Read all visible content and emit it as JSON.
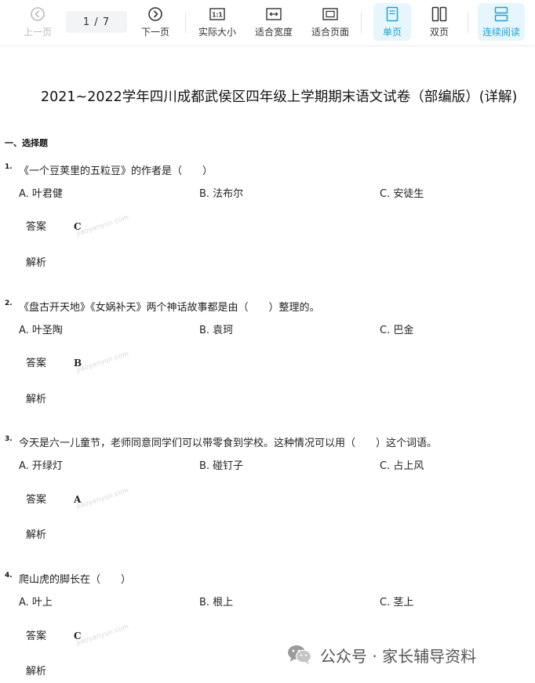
{
  "toolbar": {
    "prev_label": "上一页",
    "page_indicator": "1 / 7",
    "next_label": "下一页",
    "actual_size_label": "实际大小",
    "fit_width_label": "适合宽度",
    "fit_page_label": "适合页面",
    "single_page_label": "单页",
    "double_page_label": "双页",
    "continuous_label": "连续阅读",
    "actual_size_icon_text": "1:1",
    "accent_color": "#1aa3d6"
  },
  "document": {
    "title": "2021~2022学年四川成都武侯区四年级上学期期末语文试卷（部编版）(详解)",
    "section_heading": "一、选择题",
    "answer_label": "答案",
    "analysis_label": "解析",
    "watermark": "jiaoyanyun.com",
    "questions": [
      {
        "number": "1.",
        "text": "《一个豆荚里的五粒豆》的作者是（　　）",
        "options": [
          "A. 叶君健",
          "B. 法布尔",
          "C. 安徒生"
        ],
        "answer": "C"
      },
      {
        "number": "2.",
        "text": "《盘古开天地》《女娲补天》两个神话故事都是由（　　）整理的。",
        "options": [
          "A. 叶圣陶",
          "B. 袁珂",
          "C. 巴金"
        ],
        "answer": "B"
      },
      {
        "number": "3.",
        "text": "今天是六一儿童节，老师同意同学们可以带零食到学校。这种情况可以用（　　）这个词语。",
        "options": [
          "A. 开绿灯",
          "B. 碰钉子",
          "C. 占上风"
        ],
        "answer": "A"
      },
      {
        "number": "4.",
        "text": "爬山虎的脚长在（　　）",
        "options": [
          "A. 叶上",
          "B. 根上",
          "C. 茎上"
        ],
        "answer": "C"
      }
    ]
  },
  "footer": {
    "wechat_text": "公众号 · 家长辅导资料",
    "wechat_icon": "wechat-icon"
  }
}
